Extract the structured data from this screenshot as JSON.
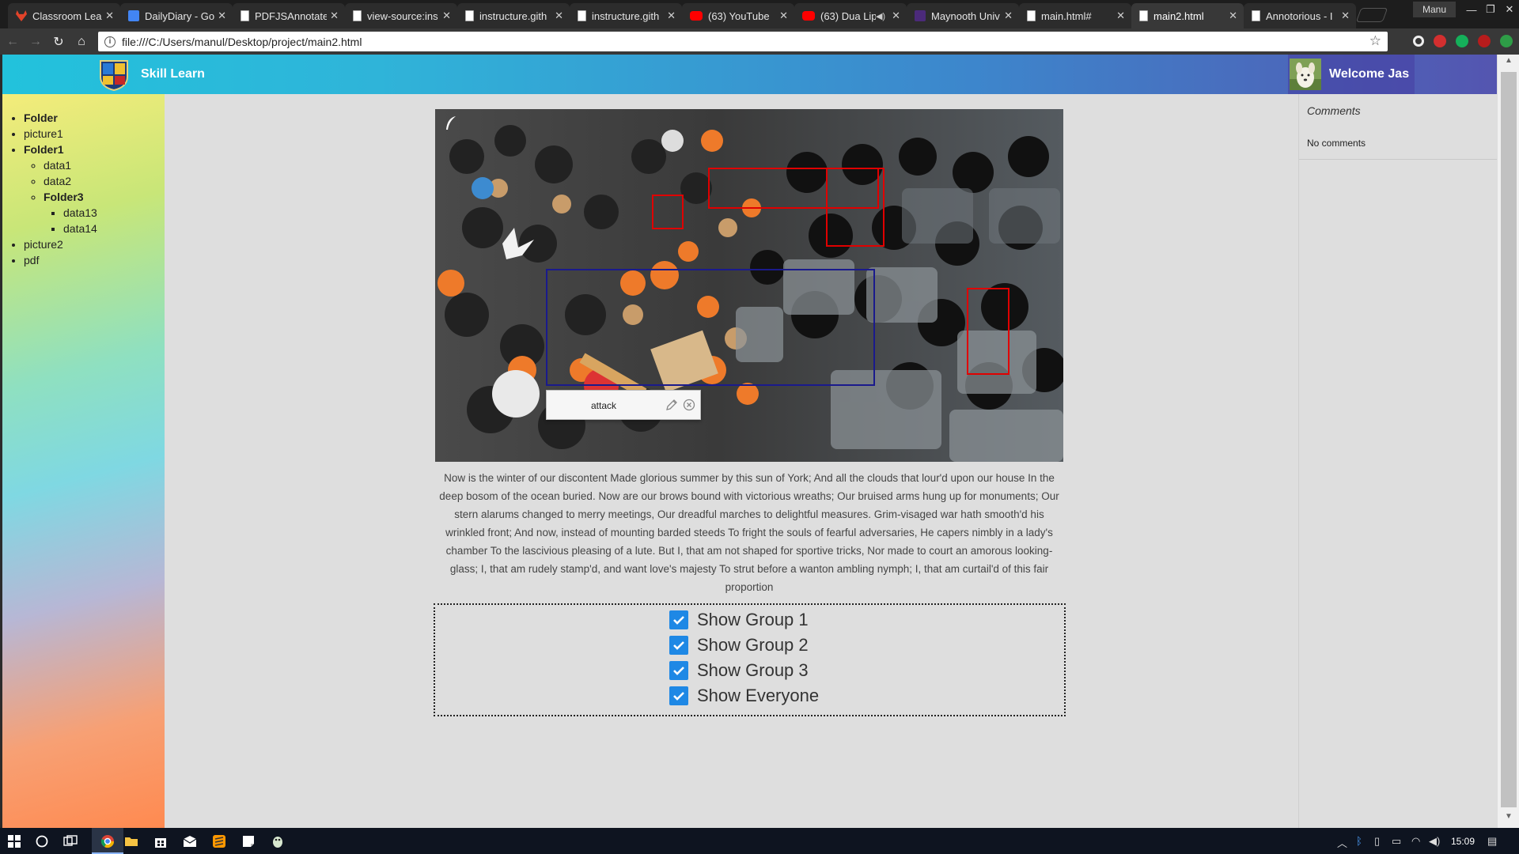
{
  "browser": {
    "tabs": [
      {
        "title": "Classroom Lear",
        "icon": "gitlab-icon"
      },
      {
        "title": "DailyDiary - Go",
        "icon": "google-docs-icon"
      },
      {
        "title": "PDFJSAnnotate",
        "icon": "document-icon"
      },
      {
        "title": "view-source:ins",
        "icon": "document-icon"
      },
      {
        "title": "instructure.gith",
        "icon": "document-icon"
      },
      {
        "title": "instructure.gith",
        "icon": "document-icon"
      },
      {
        "title": "(63) YouTube",
        "icon": "youtube-icon"
      },
      {
        "title": "(63) Dua Lip",
        "icon": "youtube-icon"
      },
      {
        "title": "Maynooth Univ",
        "icon": "maynooth-icon"
      },
      {
        "title": "main.html#",
        "icon": "document-icon"
      },
      {
        "title": "main2.html",
        "icon": "document-icon"
      },
      {
        "title": "Annotorious - I",
        "icon": "document-icon"
      }
    ],
    "active_tab_index": 10,
    "profile_label": "Manu",
    "url": "file:///C:/Users/manul/Desktop/project/main2.html"
  },
  "header": {
    "brand": "Skill Learn",
    "welcome": "Welcome Jas"
  },
  "sidebar": {
    "folder_label": "Folder",
    "picture1": "picture1",
    "folder1_label": "Folder1",
    "data1": "data1",
    "data2": "data2",
    "folder3_label": "Folder3",
    "data13": "data13",
    "data14": "data14",
    "picture2": "picture2",
    "pdf": "pdf"
  },
  "comments": {
    "title": "Comments",
    "empty": "No comments"
  },
  "annotation": {
    "text": "attack"
  },
  "paragraph": "Now is the winter of our discontent Made glorious summer by this sun of York; And all the clouds that lour'd upon our house In the deep bosom of the ocean buried. Now are our brows bound with victorious wreaths; Our bruised arms hung up for monuments; Our stern alarums changed to merry meetings, Our dreadful marches to delightful measures. Grim-visaged war hath smooth'd his wrinkled front; And now, instead of mounting barded steeds To fright the souls of fearful adversaries, He capers nimbly in a lady's chamber To the lascivious pleasing of a lute. But I, that am not shaped for sportive tricks, Nor made to court an amorous looking-glass; I, that am rudely stamp'd, and want love's majesty To strut before a wanton ambling nymph; I, that am curtail'd of this fair proportion",
  "groups": [
    {
      "label": "Show Group 1",
      "checked": true
    },
    {
      "label": "Show Group 2",
      "checked": true
    },
    {
      "label": "Show Group 3",
      "checked": true
    },
    {
      "label": "Show Everyone",
      "checked": true
    }
  ],
  "taskbar": {
    "clock": "15:09"
  },
  "colors": {
    "checkbox": "#1e88e5",
    "annotation_box": "#e00000",
    "selected_box": "#1a1a8c"
  }
}
